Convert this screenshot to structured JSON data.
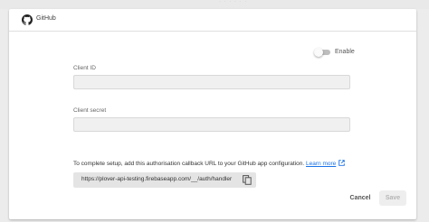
{
  "header": {
    "title": "GitHub",
    "icon": "github-icon"
  },
  "toggle": {
    "label": "Enable",
    "enabled": false
  },
  "fields": [
    {
      "label": "Client ID",
      "value": ""
    },
    {
      "label": "Client secret",
      "value": ""
    }
  ],
  "info": {
    "text": "To complete setup, add this authorisation callback URL to your GitHub app configuration.",
    "link_text": "Learn more"
  },
  "callback_url": "https://plover-api-testing.firebaseapp.com/__/auth/handler",
  "actions": {
    "cancel_label": "Cancel",
    "save_label": "Save"
  },
  "colors": {
    "link": "#1a73e8",
    "input_bg": "#f0f0f0",
    "url_bg": "#e4e4e4"
  }
}
